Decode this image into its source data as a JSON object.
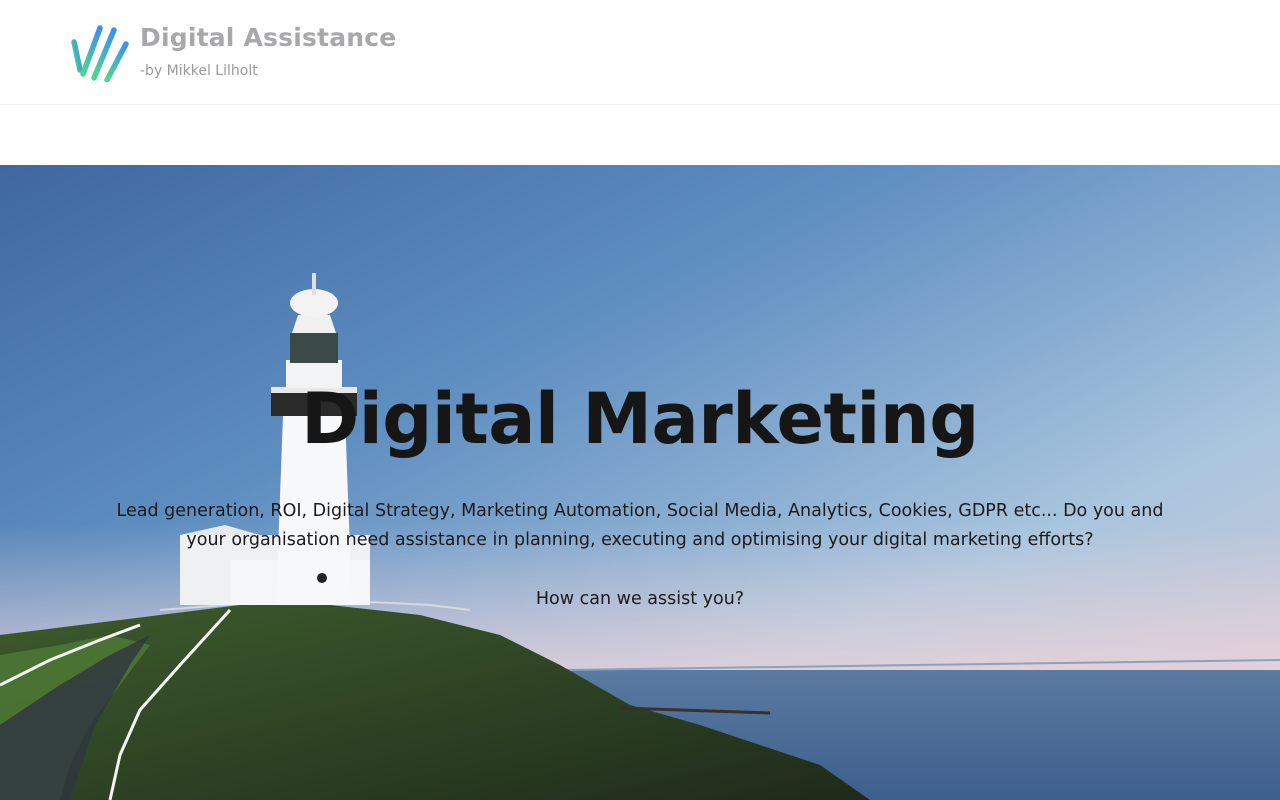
{
  "header": {
    "site_title": "Digital Assistance",
    "tagline": "-by Mikkel Lilholt",
    "logo_icon": "diagonal-stripes-logo",
    "title_color": "#a8a8aa"
  },
  "hero": {
    "title": "Digital Marketing",
    "description": "Lead generation, ROI, Digital Strategy, Marketing Automation, Social Media, Analytics, Cookies, GDPR etc... Do you and your organisation need assistance in planning, executing and optimising your digital marketing efforts?",
    "question": "How can we assist you?",
    "background": "lighthouse-on-cliff-by-sea"
  }
}
